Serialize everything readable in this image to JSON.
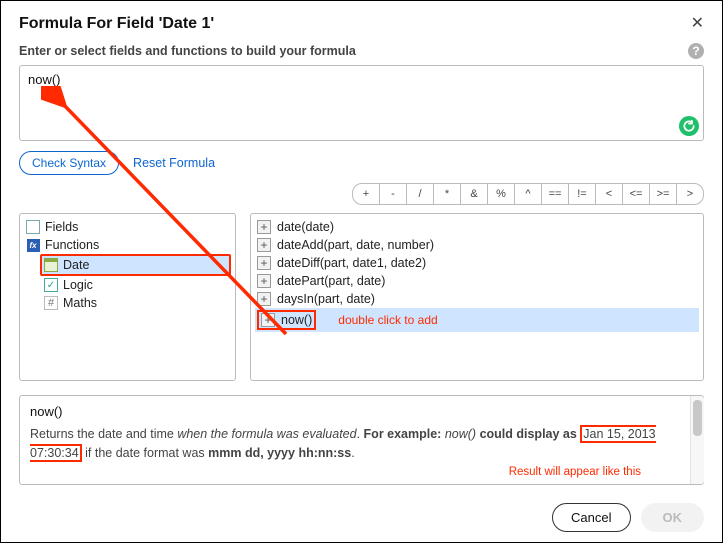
{
  "title": "Formula For Field 'Date 1'",
  "subtitle": "Enter or select fields and functions to build your formula",
  "formula_value": "now()",
  "buttons": {
    "check_syntax": "Check Syntax",
    "reset_formula": "Reset Formula",
    "cancel": "Cancel",
    "ok": "OK"
  },
  "operators": [
    "+",
    "-",
    "/",
    "*",
    "&",
    "%",
    "^",
    "==",
    "!=",
    "<",
    "<=",
    ">=",
    ">"
  ],
  "tree": {
    "fields": "Fields",
    "functions": "Functions",
    "categories": {
      "date": "Date",
      "logic": "Logic",
      "maths": "Maths"
    }
  },
  "functions": [
    "date(date)",
    "dateAdd(part, date, number)",
    "dateDiff(part, date1, date2)",
    "datePart(part, date)",
    "daysIn(part, date)",
    "now()"
  ],
  "annotations": {
    "double_click": "double click to add",
    "result_caption": "Result will appear like this"
  },
  "description": {
    "name": "now()",
    "text1": "Returns the date and time ",
    "em1": "when the formula was evaluated",
    "text2": ".  ",
    "strong1": "For example:",
    "em2": " now() ",
    "strong2": "could display as ",
    "boxed_example": "Jan 15, 2013 07:30:34",
    "text3": " if the date format was ",
    "strong3": "mmm dd, yyyy hh:nn:ss",
    "text4": "."
  }
}
